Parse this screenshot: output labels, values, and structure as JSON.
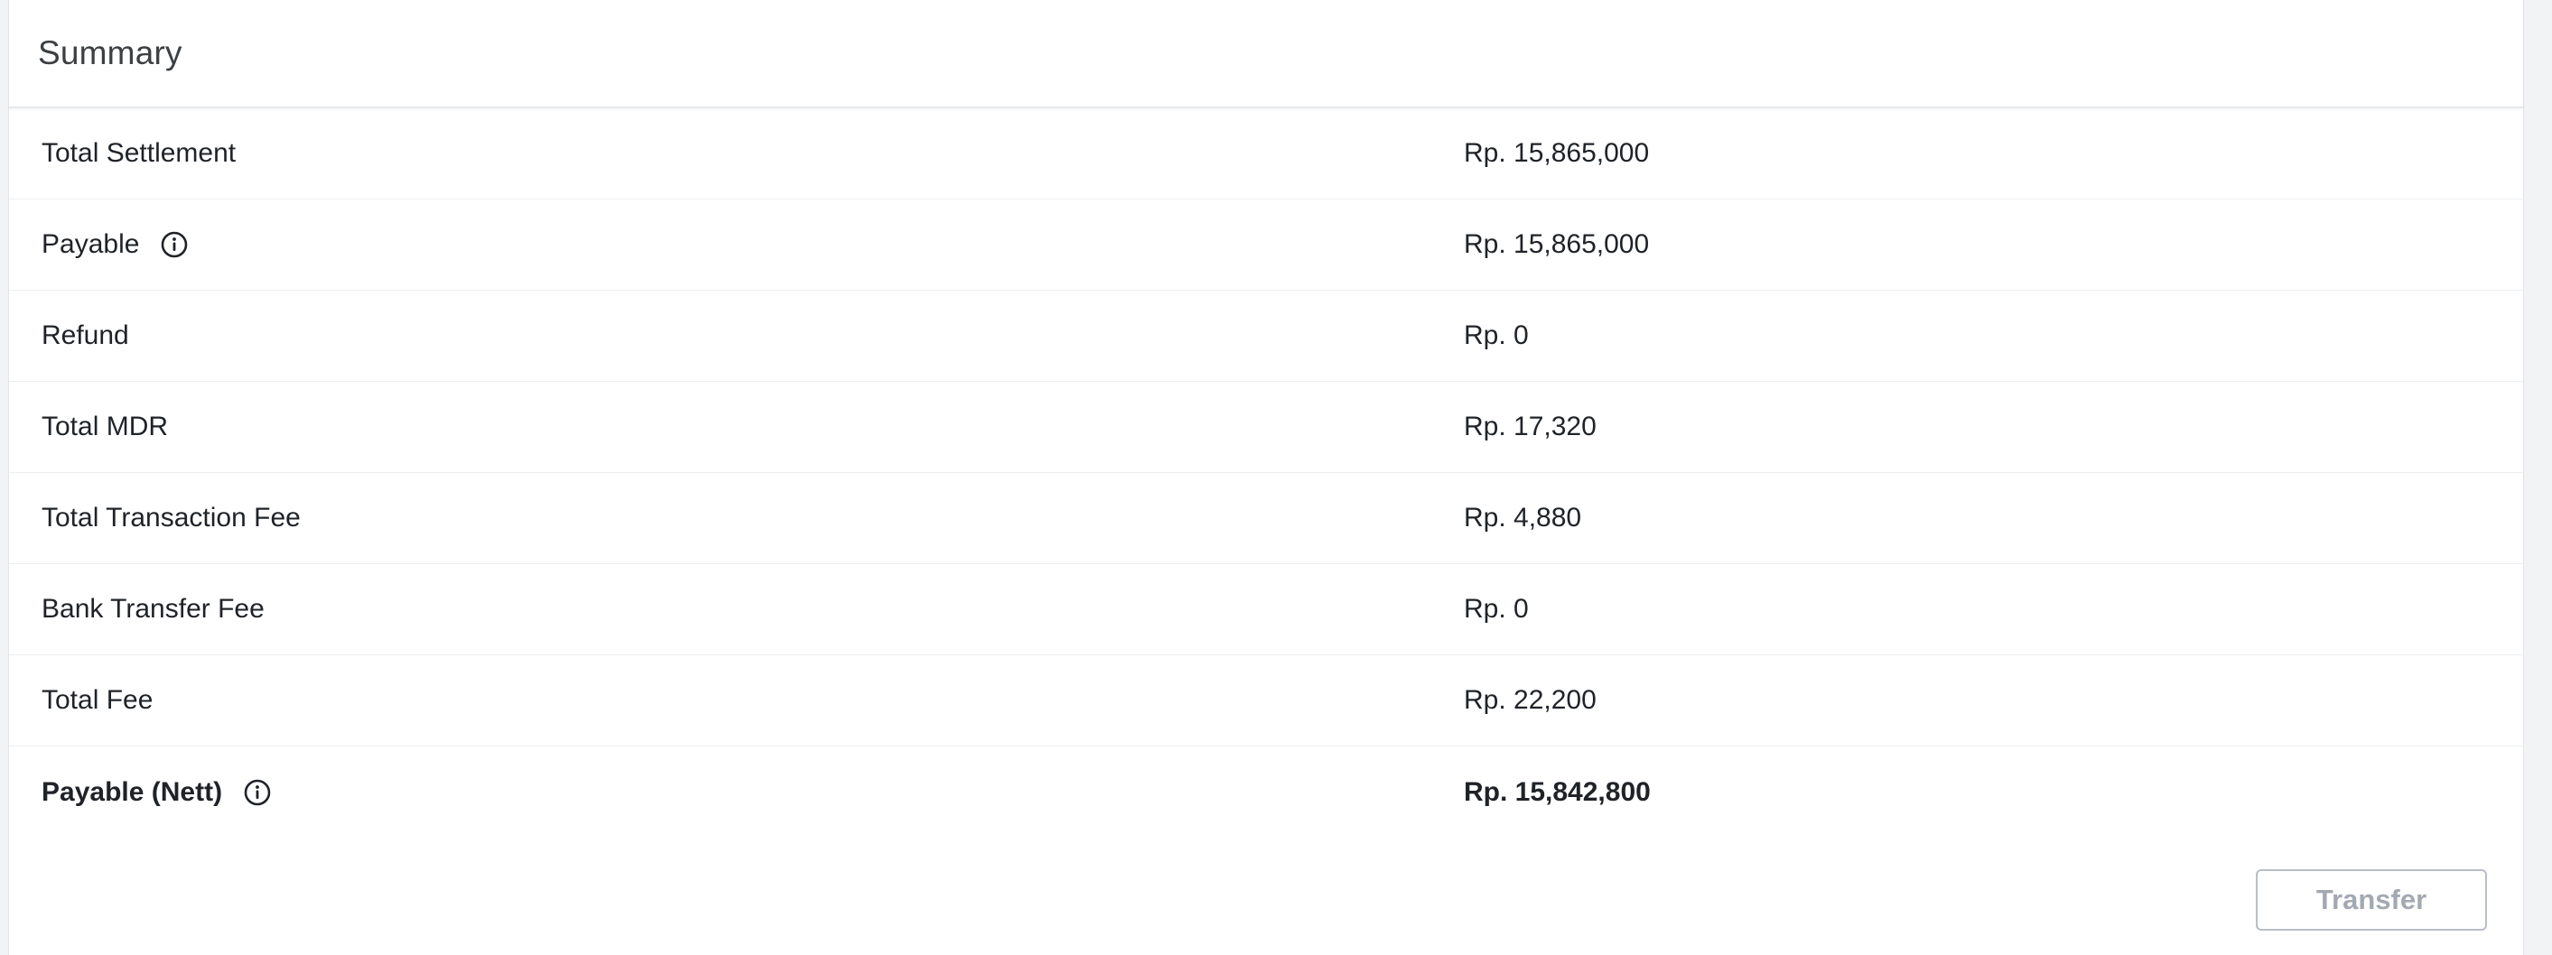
{
  "summary": {
    "title": "Summary",
    "rows": [
      {
        "label": "Total Settlement",
        "value": "Rp. 15,865,000"
      },
      {
        "label": "Payable",
        "value": "Rp. 15,865,000",
        "info_icon": "info-circle-icon"
      },
      {
        "label": "Refund",
        "value": "Rp. 0"
      },
      {
        "label": "Total MDR",
        "value": "Rp. 17,320"
      },
      {
        "label": "Total Transaction Fee",
        "value": "Rp. 4,880"
      },
      {
        "label": "Bank Transfer Fee",
        "value": "Rp. 0"
      },
      {
        "label": "Total Fee",
        "value": "Rp. 22,200"
      },
      {
        "label": "Payable (Nett)",
        "value": "Rp. 15,842,800",
        "info_icon": "info-circle-icon",
        "bold": true
      }
    ],
    "transfer_button": {
      "label": "Transfer",
      "enabled": false
    }
  }
}
